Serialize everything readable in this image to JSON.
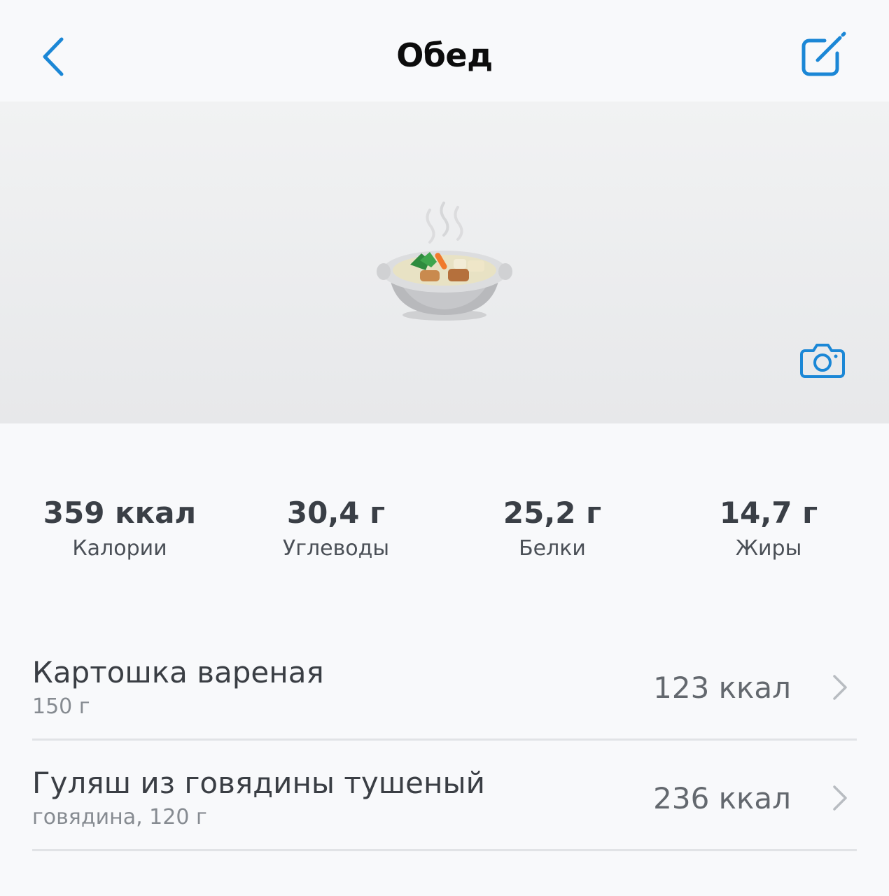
{
  "header": {
    "title": "Обед",
    "back_icon": "chevron-left-icon",
    "edit_icon": "edit-icon",
    "accent": "#1b87d6"
  },
  "photo": {
    "dish_icon": "soup-pot-icon",
    "camera_icon": "camera-icon"
  },
  "nutrition": [
    {
      "value": "359 ккал",
      "label": "Калории"
    },
    {
      "value": "30,4 г",
      "label": "Углеводы"
    },
    {
      "value": "25,2 г",
      "label": "Белки"
    },
    {
      "value": "14,7 г",
      "label": "Жиры"
    }
  ],
  "foods": [
    {
      "name": "Картошка вареная",
      "sub": "150 г",
      "kcal": "123 ккал"
    },
    {
      "name": "Гуляш из говядины тушеный",
      "sub": "говядина, 120 г",
      "kcal": "236 ккал"
    }
  ]
}
